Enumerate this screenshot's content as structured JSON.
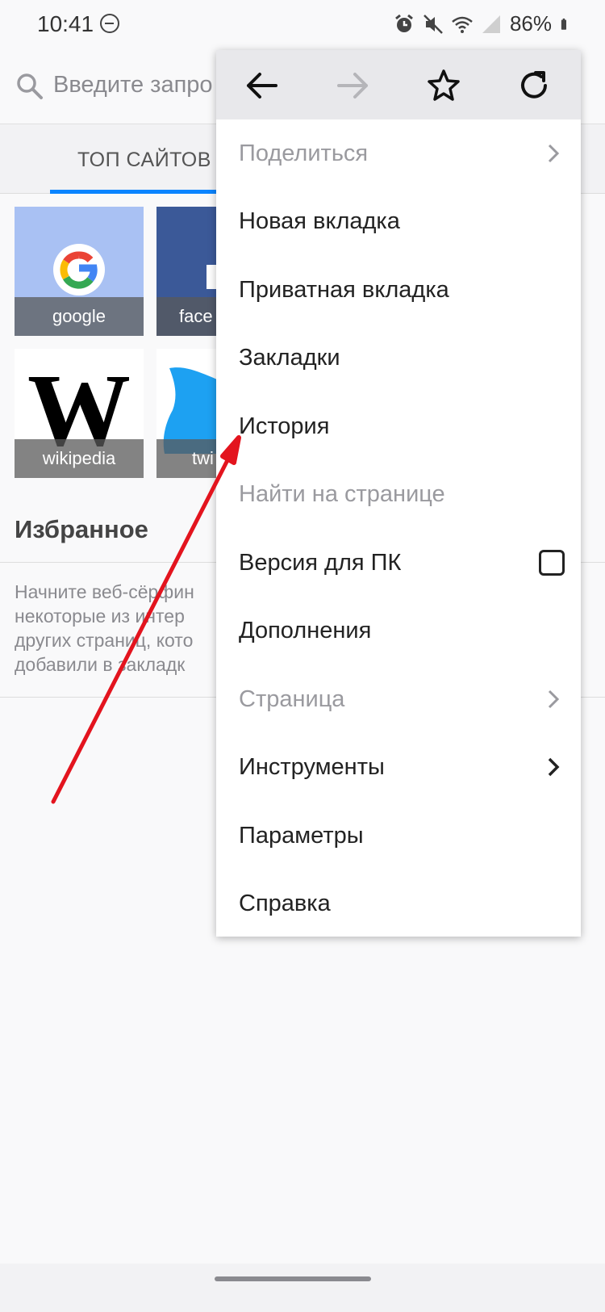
{
  "status_bar": {
    "time": "10:41",
    "battery": "86%",
    "icons": [
      "dnd-icon",
      "alarm-icon",
      "mute-icon",
      "wifi-icon",
      "signal-icon",
      "battery-icon"
    ]
  },
  "urlbar": {
    "placeholder": "Введите запро"
  },
  "tabs": {
    "top_sites": "ТОП САЙТОВ"
  },
  "tiles": [
    {
      "caption": "google"
    },
    {
      "caption": "face"
    },
    {
      "caption": "wikipedia"
    },
    {
      "caption": "twi"
    }
  ],
  "favorites": {
    "title": "Избранное",
    "desc_lines": [
      "Начните веб-сёрфин",
      "некоторые из интер",
      "других страниц, кото",
      "добавили в закладк"
    ]
  },
  "menu": {
    "nav_icons": [
      "back-arrow-icon",
      "forward-arrow-icon",
      "star-icon",
      "reload-icon"
    ],
    "items": [
      {
        "label": "Поделиться",
        "disabled": true,
        "chevron": true
      },
      {
        "label": "Новая вкладка",
        "disabled": false
      },
      {
        "label": "Приватная вкладка",
        "disabled": false
      },
      {
        "label": "Закладки",
        "disabled": false
      },
      {
        "label": "История",
        "disabled": false
      },
      {
        "label": "Найти на странице",
        "disabled": true
      },
      {
        "label": "Версия для ПК",
        "disabled": false,
        "checkbox": false
      },
      {
        "label": "Дополнения",
        "disabled": false
      },
      {
        "label": "Страница",
        "disabled": true,
        "chevron": true
      },
      {
        "label": "Инструменты",
        "disabled": false,
        "chevron": true
      },
      {
        "label": "Параметры",
        "disabled": false
      },
      {
        "label": "Справка",
        "disabled": false
      }
    ]
  },
  "colors": {
    "accent": "#0a84ff",
    "annotation_arrow": "#e3141e"
  }
}
